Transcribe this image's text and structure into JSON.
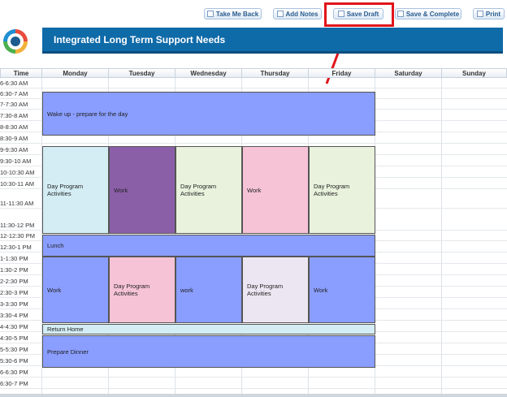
{
  "toolbar": {
    "take_me_back": "Take Me Back",
    "add_notes": "Add Notes",
    "save_draft": "Save Draft",
    "save_complete": "Save & Complete",
    "print": "Print"
  },
  "page_title": "Integrated Long Term Support Needs",
  "calendar": {
    "time_header": "Time",
    "days": [
      "Monday",
      "Tuesday",
      "Wednesday",
      "Thursday",
      "Friday",
      "Saturday",
      "Sunday"
    ],
    "time_slots": [
      "6-6:30 AM",
      "6:30-7 AM",
      "7-7:30 AM",
      "7:30-8 AM",
      "8-8:30 AM",
      "8:30-9 AM",
      "9-9:30 AM",
      "9:30-10 AM",
      "10-10:30 AM",
      "10:30-11 AM",
      "11-11:30 AM",
      "11:30-12 PM",
      "12-12:30 PM",
      "12:30-1 PM",
      "1-1:30 PM",
      "1:30-2 PM",
      "2-2:30 PM",
      "2:30-3 PM",
      "3-3:30 PM",
      "3:30-4 PM",
      "4-4:30 PM",
      "4:30-5 PM",
      "5-5:30 PM",
      "5:30-6 PM",
      "6-6:30 PM",
      "6:30-7 PM"
    ],
    "events": {
      "wake_up": "Wake up - prepare for the day",
      "mon_am": "Day Program Activities",
      "tue_am": "Work",
      "wed_am": "Day Program Activities",
      "thu_am": "Work",
      "fri_am": "Day Program Activities",
      "lunch": "Lunch",
      "mon_pm": "Work",
      "tue_pm": "Day Program Activities",
      "wed_pm": "work",
      "thu_pm": "Day Program Activities",
      "fri_pm": "Work",
      "return_home": "Return Home",
      "prepare_dinner": "Prepare Dinner"
    },
    "colors": {
      "blue": "#8a9eff",
      "light_blue": "#d4edf4",
      "purple": "#8b5fa8",
      "light_green": "#e8f2dc",
      "pink": "#f6c3d6",
      "lavender": "#ece6f2",
      "return_home": "#d4edf4"
    }
  },
  "annotation": {
    "highlight_color": "#e0151a"
  }
}
